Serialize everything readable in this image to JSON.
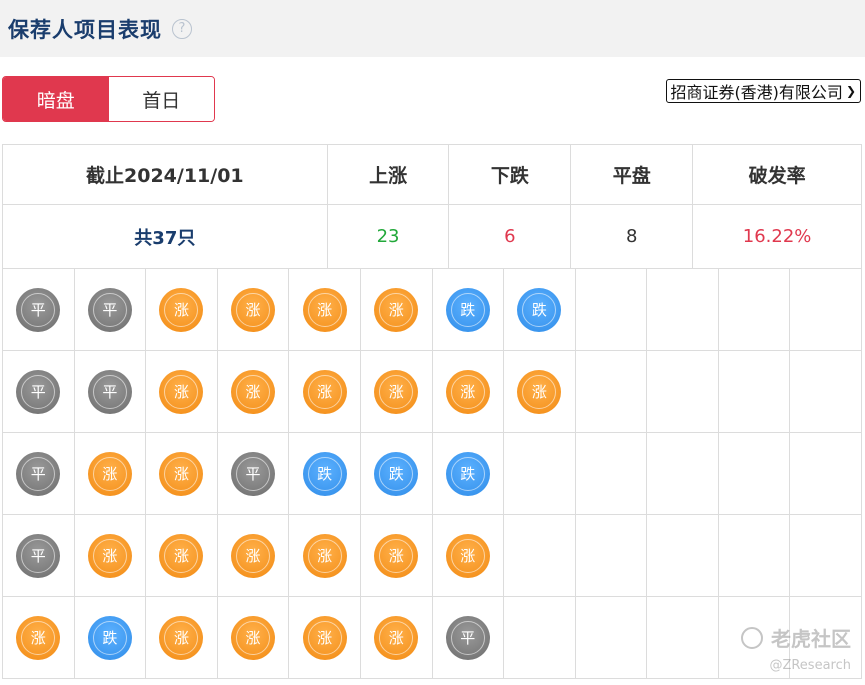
{
  "header": {
    "title": "保荐人项目表现",
    "help_icon": "?"
  },
  "tabs": [
    {
      "label": "暗盘",
      "active": true
    },
    {
      "label": "首日",
      "active": false
    }
  ],
  "broker_select": {
    "value": "招商证券(香港)有限公司"
  },
  "summary": {
    "date_label": "截止2024/11/01",
    "up_label": "上涨",
    "down_label": "下跌",
    "flat_label": "平盘",
    "break_label": "破发率",
    "total": "共37只",
    "up_count": "23",
    "down_count": "6",
    "flat_count": "8",
    "break_rate": "16.22%"
  },
  "coin_labels": {
    "up": "涨",
    "down": "跌",
    "flat": "平"
  },
  "coin_colors": {
    "up": "#f59a23",
    "down": "#3a95f0",
    "flat": "#808080"
  },
  "grid_rows": [
    [
      "flat",
      "flat",
      "up",
      "up",
      "up",
      "up",
      "down",
      "down"
    ],
    [
      "flat",
      "flat",
      "up",
      "up",
      "up",
      "up",
      "up",
      "up"
    ],
    [
      "flat",
      "up",
      "up",
      "flat",
      "down",
      "down",
      "down"
    ],
    [
      "flat",
      "up",
      "up",
      "up",
      "up",
      "up",
      "up"
    ],
    [
      "up",
      "down",
      "up",
      "up",
      "up",
      "up",
      "flat"
    ]
  ],
  "watermark": {
    "brand": "老虎社区",
    "handle": "@ZResearch"
  }
}
